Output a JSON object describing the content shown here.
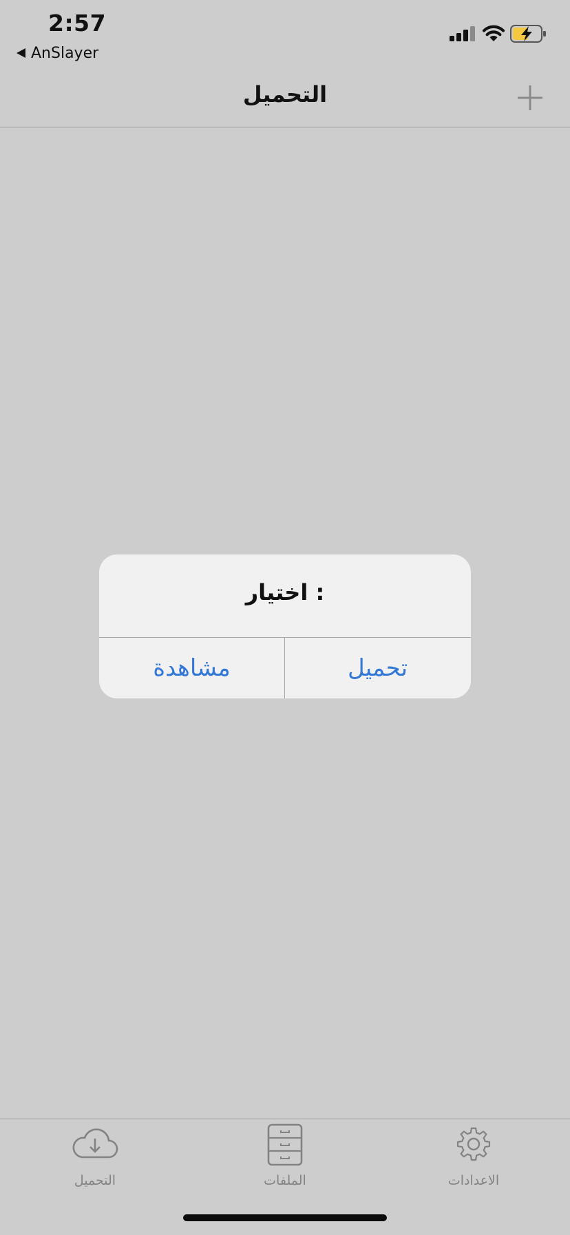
{
  "status_bar": {
    "time": "2:57",
    "back_app": "AnSlayer",
    "signal_icon": "cellular-signal-icon",
    "wifi_icon": "wifi-icon",
    "battery_icon": "battery-charging-icon",
    "battery_color": "#f5c842"
  },
  "nav": {
    "title": "التحميل",
    "add_icon": "plus-icon"
  },
  "alert": {
    "title": "اختيار :",
    "buttons": [
      "مشاهدة",
      "تحميل"
    ],
    "button_color": "#3478d6"
  },
  "tab_bar": {
    "tabs": [
      {
        "label": "التحميل",
        "icon": "cloud-download-icon"
      },
      {
        "label": "الملفات",
        "icon": "file-cabinet-icon"
      },
      {
        "label": "الاعدادات",
        "icon": "gear-icon"
      }
    ]
  }
}
